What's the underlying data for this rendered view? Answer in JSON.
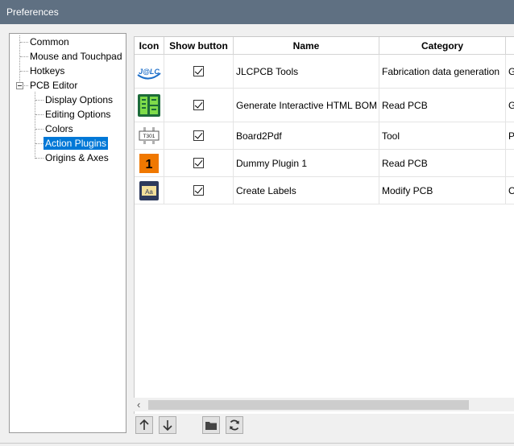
{
  "window": {
    "title": "Preferences"
  },
  "tree": {
    "items": [
      {
        "label": "Common"
      },
      {
        "label": "Mouse and Touchpad"
      },
      {
        "label": "Hotkeys"
      },
      {
        "label": "PCB Editor"
      },
      {
        "label": "Display Options"
      },
      {
        "label": "Editing Options"
      },
      {
        "label": "Colors"
      },
      {
        "label": "Action Plugins",
        "selected": true
      },
      {
        "label": "Origins & Axes"
      }
    ]
  },
  "table": {
    "columns": [
      "Icon",
      "Show button",
      "Name",
      "Category",
      ""
    ],
    "rows": [
      {
        "icon": "jlcpcb-logo-icon",
        "show_button": true,
        "name": "JLCPCB Tools",
        "category": "Fabrication data generation",
        "extra": "G"
      },
      {
        "icon": "ibom-icon",
        "show_button": true,
        "name": "Generate Interactive HTML BOM",
        "category": "Read PCB",
        "extra": "G"
      },
      {
        "icon": "board2pdf-icon",
        "show_button": true,
        "name": "Board2Pdf",
        "category": "Tool",
        "extra": "Pl"
      },
      {
        "icon": "number-one-icon",
        "show_button": true,
        "name": "Dummy Plugin 1",
        "category": "Read PCB",
        "extra": ""
      },
      {
        "icon": "create-labels-icon",
        "show_button": true,
        "name": "Create Labels",
        "category": "Modify PCB",
        "extra": "C"
      }
    ],
    "icon_texts": {
      "jlc": "J@LC",
      "board2pdf": "T301",
      "dummy": "1",
      "labels": "Aa"
    }
  },
  "toolbar": {
    "buttons": [
      "move-up-icon",
      "move-down-icon",
      "open-folder-icon",
      "refresh-icon"
    ]
  },
  "colors": {
    "selection": "#0078d7",
    "titlebar": "#5f7082",
    "dummy_icon": "#f07800"
  }
}
